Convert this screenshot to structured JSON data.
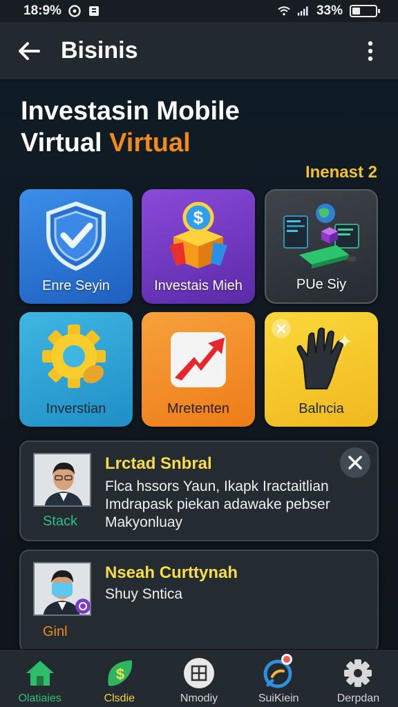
{
  "status_bar": {
    "time": "18:9%",
    "battery": "33%",
    "battery_level": 0.33,
    "icons": [
      "media-icon",
      "notification-icon",
      "wifi-icon",
      "signal-icon",
      "battery-icon"
    ]
  },
  "app_bar": {
    "title": "Bisinis",
    "back_icon": "arrow-left-icon",
    "more_icon": "more-vertical-icon"
  },
  "hero": {
    "title_line1": "Investasin Mobile",
    "title_line2_plain": "Virtual ",
    "title_line2_accent": "Virtual",
    "accent_color": "#f08a1c",
    "tag": "Inenast 2"
  },
  "tiles": [
    {
      "label": "Enre Seyin",
      "icon": "shield-check-icon"
    },
    {
      "label": "Investais Mieh",
      "icon": "dollar-box-icon"
    },
    {
      "label": "PUe Siy",
      "icon": "devices-icon"
    },
    {
      "label": "Inverstian",
      "icon": "gear-icon"
    },
    {
      "label": "Mretenten",
      "icon": "trend-up-icon"
    },
    {
      "label": "Balncia",
      "icon": "hand-glove-icon"
    }
  ],
  "cards": [
    {
      "title": "Lrctad Snbral",
      "tag": "Stack",
      "body_lines": [
        "Flca hssors Yaun, Ikapk Iractaitlian",
        "Imdrapask piekan adawake pebser",
        "Makyonluay"
      ]
    },
    {
      "title": "Nseah Curttynah",
      "tag": "Ginl",
      "body_lines": [
        "Shuy Sntica"
      ]
    }
  ],
  "bottom_nav": [
    {
      "label": "Olatiaies",
      "icon": "home-icon",
      "active": true
    },
    {
      "label": "Clsdie",
      "icon": "dollar-leaf-icon"
    },
    {
      "label": "Nmodiy",
      "icon": "grid-icon"
    },
    {
      "label": "SuiKiein",
      "icon": "chat-bubble-icon"
    },
    {
      "label": "Derpdan",
      "icon": "settings-icon"
    }
  ]
}
